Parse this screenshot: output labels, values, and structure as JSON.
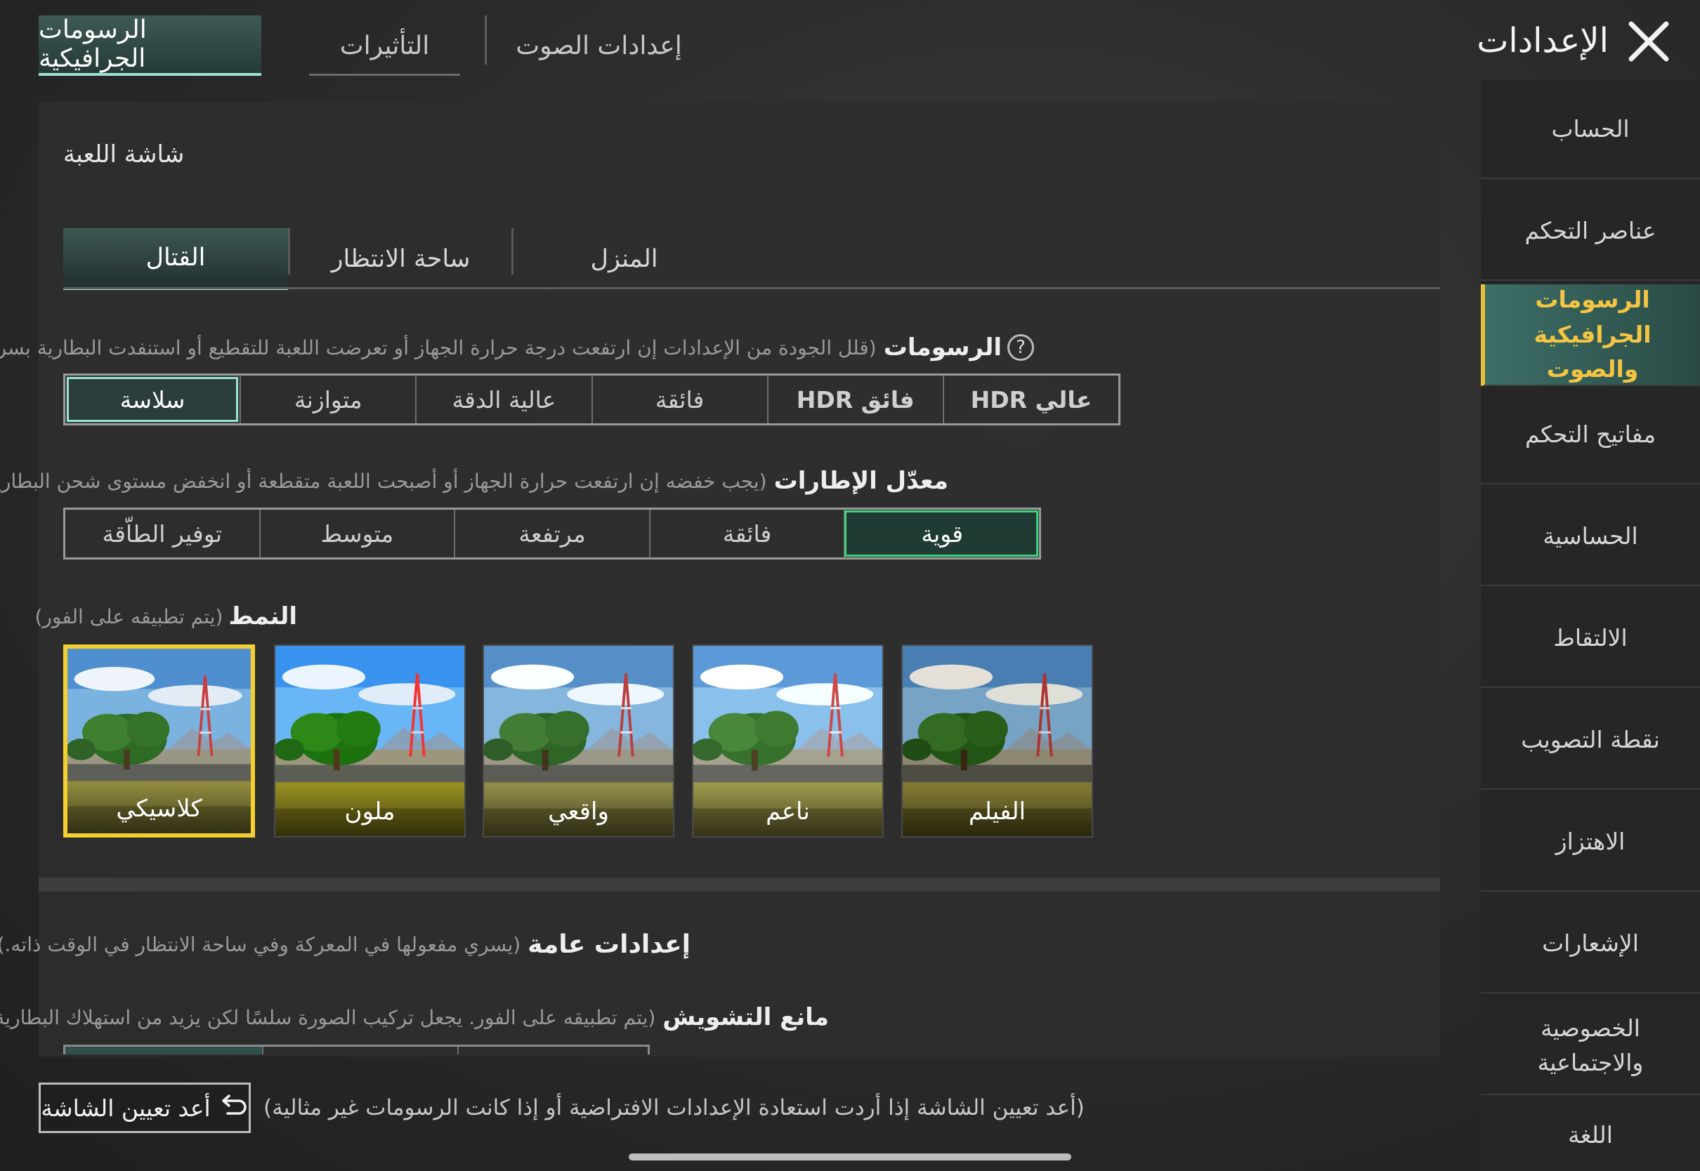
{
  "top_tabs": [
    {
      "label": "الرسومات الجرافيكية",
      "active": true
    },
    {
      "label": "التأثيرات",
      "active": false
    },
    {
      "label": "إعدادات الصوت",
      "active": false
    }
  ],
  "title": "الإعدادات",
  "nav": {
    "items": [
      {
        "label": "الحساب"
      },
      {
        "label": "عناصر التحكم"
      },
      {
        "label": "الرسومات الجرافيكية والصوت",
        "active": true
      },
      {
        "label": "مفاتيح التحكم"
      },
      {
        "label": "الحساسية"
      },
      {
        "label": "الالتقاط"
      },
      {
        "label": "نقطة التصويب"
      },
      {
        "label": "الاهتزاز"
      },
      {
        "label": "الإشعارات"
      },
      {
        "label": "الخصوصية والاجتماعية"
      },
      {
        "label": "اللغة"
      }
    ]
  },
  "screen_section": {
    "title": "شاشة اللعبة",
    "tabs": [
      {
        "label": "القتال",
        "active": true
      },
      {
        "label": "ساحة الانتظار"
      },
      {
        "label": "المنزل"
      }
    ]
  },
  "graphics": {
    "label": "الرسومات",
    "hint": "(قلل الجودة من الإعدادات إن ارتفعت درجة حرارة الجهاز أو تعرضت اللعبة للتقطيع أو استنفدت البطارية بسرعة)",
    "options": [
      "سلاسة",
      "متوازنة",
      "عالية الدقة",
      "فائقة",
      "HDR فائق",
      "HDR عالي"
    ],
    "selected": "سلاسة"
  },
  "frame_rate": {
    "label": "معدّل الإطارات",
    "hint": "(يجب خفضه إن ارتفعت حرارة الجهاز أو أصبحت اللعبة متقطعة أو انخفض مستوى شحن البطارية)",
    "options": [
      "توفير الطاّقة",
      "متوسط",
      "مرتفعة",
      "فائقة",
      "قوية"
    ],
    "selected": "قوية"
  },
  "style": {
    "label": "النمط",
    "hint": "(يتم تطبيقه على الفور)",
    "options": [
      "كلاسيكي",
      "ملون",
      "واقعي",
      "ناعم",
      "الفيلم"
    ],
    "selected": "كلاسيكي"
  },
  "general": {
    "title": "إعدادات عامة",
    "hint": "(يسري مفعولها في المعركة وفي ساحة الانتظار في الوقت ذاته.)"
  },
  "anti_aliasing": {
    "label": "مانع التشويش",
    "hint": "(يتم تطبيقه على الفور. يجعل تركيب الصورة سلسًا لكن يزيد من استهلاك البطارية.)"
  },
  "reset": {
    "button": "أعد تعيين الشاشة",
    "hint": "(أعد تعيين الشاشة إذا أردت استعادة الإعدادات الافتراضية أو إذا كانت الرسومات غير مثالية)"
  },
  "colors": {
    "accent_teal": "#9ee0d2",
    "accent_green": "#3fd07e",
    "accent_yellow": "#f3cf2f",
    "nav_active_text": "#f4c542"
  }
}
